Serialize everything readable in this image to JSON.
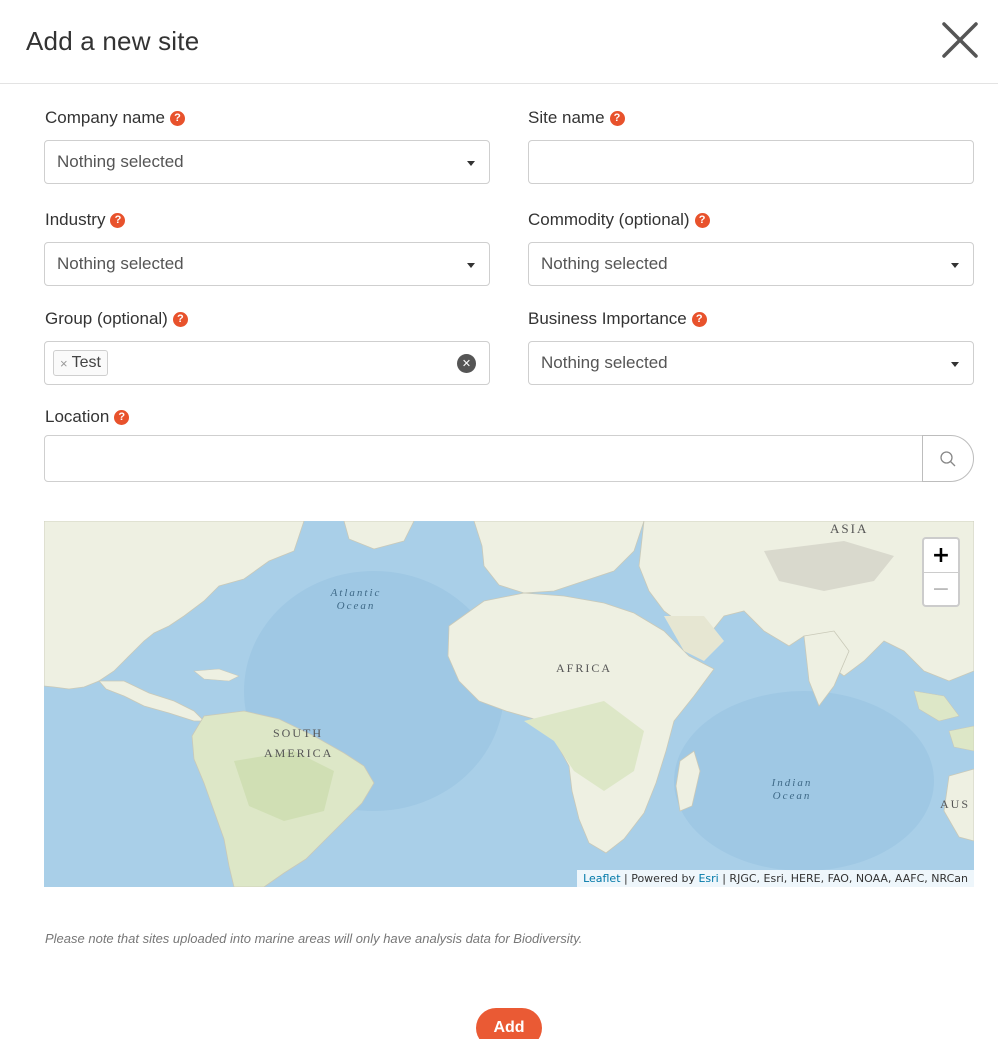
{
  "modal": {
    "title": "Add a new site",
    "close_icon": "close-icon"
  },
  "form": {
    "company_name": {
      "label": "Company name",
      "value": "Nothing selected"
    },
    "site_name": {
      "label": "Site name",
      "value": ""
    },
    "industry": {
      "label": "Industry",
      "value": "Nothing selected"
    },
    "commodity": {
      "label": "Commodity (optional)",
      "value": "Nothing selected"
    },
    "group": {
      "label": "Group (optional)",
      "tags": [
        "Test"
      ],
      "tag_remove": "×"
    },
    "business_importance": {
      "label": "Business Importance",
      "value": "Nothing selected"
    },
    "location": {
      "label": "Location",
      "value": ""
    },
    "help_glyph": "?"
  },
  "map": {
    "zoom_in": "+",
    "zoom_out": "−",
    "labels": {
      "asia": "ASIA",
      "africa": "AFRICA",
      "south_america_1": "SOUTH",
      "south_america_2": "AMERICA",
      "aus": "AUS",
      "atlantic_1": "Atlantic",
      "atlantic_2": "Ocean",
      "indian_1": "Indian",
      "indian_2": "Ocean"
    },
    "attribution": {
      "leaflet": "Leaflet",
      "sep1": " | Powered by ",
      "esri": "Esri",
      "rest": " | RJGC, Esri, HERE, FAO, NOAA, AAFC, NRCan"
    }
  },
  "note": "Please note that sites uploaded into marine areas will only have analysis data for Biodiversity.",
  "actions": {
    "add_label": "Add"
  },
  "colors": {
    "accent": "#ea5a34",
    "help": "#e8522c",
    "ocean": "#a9cfe8",
    "land": "#eef0e2"
  }
}
